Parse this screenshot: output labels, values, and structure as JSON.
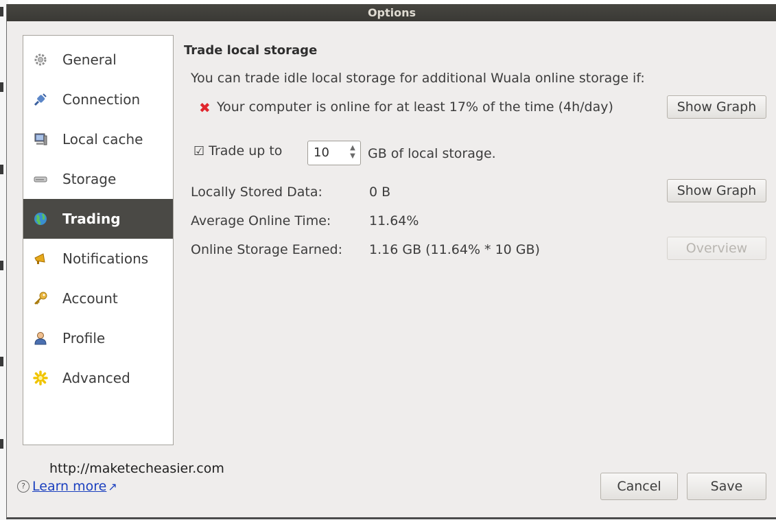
{
  "window": {
    "title": "Options"
  },
  "sidebar": {
    "items": [
      {
        "label": "General",
        "icon": "gear-icon"
      },
      {
        "label": "Connection",
        "icon": "plug-icon"
      },
      {
        "label": "Local cache",
        "icon": "computer-icon"
      },
      {
        "label": "Storage",
        "icon": "hard-drive-icon"
      },
      {
        "label": "Trading",
        "icon": "globe-icon",
        "active": true
      },
      {
        "label": "Notifications",
        "icon": "megaphone-icon"
      },
      {
        "label": "Account",
        "icon": "key-icon"
      },
      {
        "label": "Profile",
        "icon": "person-icon"
      },
      {
        "label": "Advanced",
        "icon": "star-icon"
      }
    ]
  },
  "trading": {
    "title": "Trade local storage",
    "intro": "You can trade idle local storage for additional Wuala online storage if:",
    "requirement": "Your computer is online for at least 17% of the time (4h/day)",
    "requirement_met": false,
    "show_graph_label": "Show Graph",
    "trade_prefix": "Trade up to",
    "trade_value": "10",
    "trade_suffix": "GB of local storage.",
    "trade_checked": true,
    "locally_stored_label": "Locally Stored Data:",
    "locally_stored_value": "0 B",
    "avg_online_label": "Average Online Time:",
    "avg_online_value": "11.64%",
    "earned_label": "Online Storage Earned:",
    "earned_value": "1.16 GB (11.64% * 10 GB)",
    "overview_label": "Overview"
  },
  "footer": {
    "watermark": "http://maketecheasier.com",
    "learn_more": "Learn more",
    "cancel_label": "Cancel",
    "save_label": "Save"
  },
  "colors": {
    "accent_active": "#4a4945",
    "link": "#1a3fbf",
    "error": "#e0262d"
  }
}
